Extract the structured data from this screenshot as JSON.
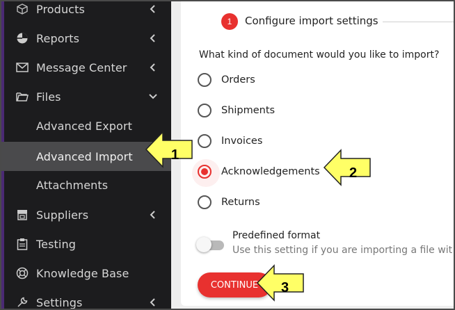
{
  "sidebar": {
    "items": [
      {
        "label": "Products",
        "icon": "box-icon",
        "chevron": "left"
      },
      {
        "label": "Reports",
        "icon": "pie-chart-icon",
        "chevron": "left"
      },
      {
        "label": "Message Center",
        "icon": "envelope-icon",
        "chevron": "left"
      },
      {
        "label": "Files",
        "icon": "folder-icon",
        "chevron": "down"
      },
      {
        "label": "Advanced Export",
        "sub": true
      },
      {
        "label": "Advanced Import",
        "sub": true,
        "active": true
      },
      {
        "label": "Attachments",
        "sub": true
      },
      {
        "label": "Suppliers",
        "icon": "store-icon",
        "chevron": "left"
      },
      {
        "label": "Testing",
        "icon": "clipboard-icon"
      },
      {
        "label": "Knowledge Base",
        "icon": "lifebuoy-icon"
      },
      {
        "label": "Settings",
        "icon": "wrench-icon",
        "chevron": "left"
      }
    ]
  },
  "step": {
    "number": "1",
    "title": "Configure import settings"
  },
  "question": "What kind of document would you like to import?",
  "options": [
    {
      "label": "Orders",
      "checked": false
    },
    {
      "label": "Shipments",
      "checked": false
    },
    {
      "label": "Invoices",
      "checked": false
    },
    {
      "label": "Acknowledgements",
      "checked": true
    },
    {
      "label": "Returns",
      "checked": false
    }
  ],
  "predefined_format": {
    "title": "Predefined format",
    "description": "Use this setting if you are importing a file wit",
    "enabled": false
  },
  "continue_label": "CONTINUE",
  "callouts": [
    "1",
    "2",
    "3"
  ],
  "colors": {
    "accent": "#e8312f",
    "sidebar": "#1c1c1e",
    "callout_fill": "#ffff66"
  }
}
